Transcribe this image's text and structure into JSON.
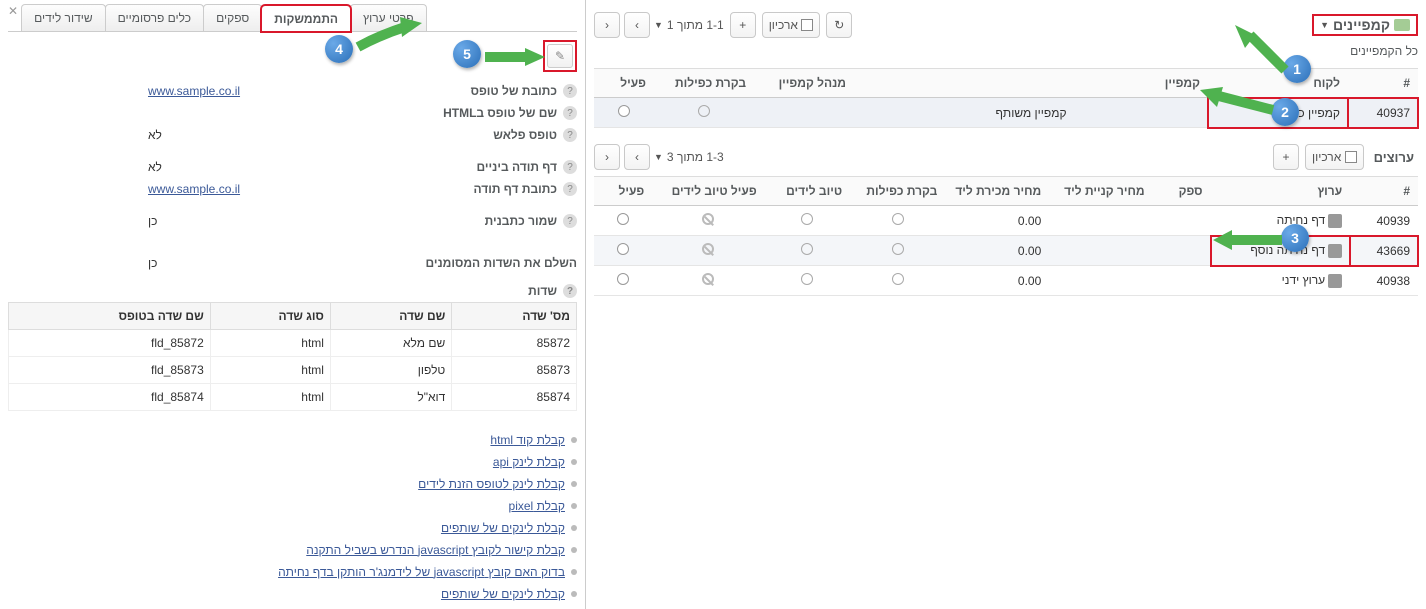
{
  "header": {
    "title": "קמפיינים",
    "subtitle": "כל הקמפיינים",
    "archive_label": "ארכיון"
  },
  "campaigns": {
    "pager": "1-1 מתוך 1",
    "cols": {
      "num": "#",
      "client": "לקוח",
      "campaign": "קמפיין",
      "mgr": "מנהל קמפיין",
      "dup": "בקרת כפילות",
      "active": "פעיל"
    },
    "rows": [
      {
        "num": "40937",
        "client": "קמפיין כללי",
        "campaign": "קמפיין משותף"
      }
    ]
  },
  "channels": {
    "title": "ערוצים",
    "archive_label": "ארכיון",
    "pager": "1-3 מתוך 3",
    "cols": {
      "num": "#",
      "channel": "ערוץ",
      "supplier": "ספק",
      "buy": "מחיר קניית ליד",
      "sell": "מחיר מכירת ליד",
      "dup": "בקרת כפילות",
      "ldraft": "טיוב לידים",
      "ldraft_active": "פעיל טיוב לידים",
      "active": "פעיל"
    },
    "rows": [
      {
        "num": "40939",
        "channel": "דף נחיתה",
        "buy": "",
        "sell": "0.00"
      },
      {
        "num": "43669",
        "channel": "דף נחיתה נוסף",
        "buy": "",
        "sell": "0.00"
      },
      {
        "num": "40938",
        "channel": "ערוץ ידני",
        "buy": "",
        "sell": "0.00"
      }
    ]
  },
  "tabs": {
    "t1": "פרטי ערוץ",
    "t2": "התממשקות",
    "t3": "ספקים",
    "t4": "כלים פרסומיים",
    "t5": "שידור לידים"
  },
  "details": {
    "form_url_label": "כתובת של טופס",
    "form_url_val": "www.sample.co.il",
    "form_name_label": "שם של טופס בHTML",
    "flash_label": "טופס פלאש",
    "flash_val": "לא",
    "interim_label": "דף תודה ביניים",
    "interim_val": "לא",
    "thank_url_label": "כתובת דף תודה",
    "thank_url_val": "www.sample.co.il",
    "save_tpl_label": "שמור כתבנית",
    "save_tpl_val": "כן",
    "complete_label": "השלם את השדות המסומנים",
    "complete_val": "כן",
    "fields_label": "שדות"
  },
  "field_table": {
    "cols": {
      "num": "מס' שדה",
      "name": "שם שדה",
      "type": "סוג שדה",
      "form_name": "שם שדה בטופס"
    },
    "rows": [
      {
        "num": "85872",
        "name": "שם מלא",
        "type": "html",
        "form_name": "fld_85872"
      },
      {
        "num": "85873",
        "name": "טלפון",
        "type": "html",
        "form_name": "fld_85873"
      },
      {
        "num": "85874",
        "name": "דוא\"ל",
        "type": "html",
        "form_name": "fld_85874"
      }
    ]
  },
  "links": {
    "l1": "קבלת קוד html",
    "l2": "קבלת לינק api",
    "l3": "קבלת לינק לטופס הזנת לידים",
    "l4": "קבלת pixel",
    "l5": "קבלת לינקים של שותפים",
    "l6": "קבלת קישור לקובץ javascript הנדרש בשביל התקנה",
    "l7": "בדוק האם קובץ javascript של לידמנג'ר הותקן בדף נחיתה",
    "l8": "קבלת לינקים של שותפים"
  },
  "annot": {
    "n1": "1",
    "n2": "2",
    "n3": "3",
    "n4": "4",
    "n5": "5"
  }
}
